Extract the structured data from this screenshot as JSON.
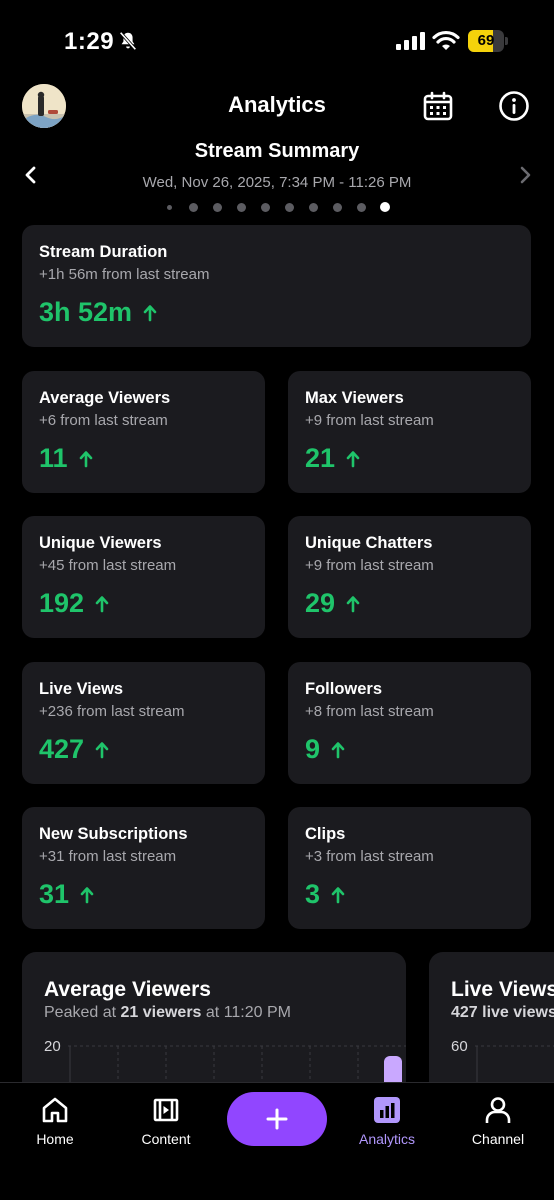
{
  "status_bar": {
    "time": "1:29",
    "battery": "69",
    "battery_level": 0.69
  },
  "header": {
    "title": "Analytics"
  },
  "summary": {
    "title": "Stream Summary",
    "date_range": "Wed, Nov 26, 2025, 7:34 PM - 11:26 PM",
    "page_count": 10,
    "active_page": 10
  },
  "stats": {
    "duration": {
      "title": "Stream Duration",
      "sub": "+1h 56m from last stream",
      "value": "3h 52m"
    },
    "avg_viewers": {
      "title": "Average Viewers",
      "sub": "+6 from last stream",
      "value": "11"
    },
    "max_viewers": {
      "title": "Max Viewers",
      "sub": "+9 from last stream",
      "value": "21"
    },
    "unique_viewers": {
      "title": "Unique Viewers",
      "sub": "+45 from last stream",
      "value": "192"
    },
    "unique_chatters": {
      "title": "Unique Chatters",
      "sub": "+9 from last stream",
      "value": "29"
    },
    "live_views": {
      "title": "Live Views",
      "sub": "+236 from last stream",
      "value": "427"
    },
    "followers": {
      "title": "Followers",
      "sub": "+8 from last stream",
      "value": "9"
    },
    "new_subs": {
      "title": "New Subscriptions",
      "sub": "+31 from last stream",
      "value": "31"
    },
    "clips": {
      "title": "Clips",
      "sub": "+3 from last stream",
      "value": "3"
    }
  },
  "charts": {
    "avg_viewers": {
      "title": "Average Viewers",
      "sub_prefix": "Peaked at ",
      "sub_bold": "21 viewers",
      "sub_suffix": " at 11:20 PM",
      "axis_top": "20"
    },
    "live_views": {
      "title": "Live Views",
      "sub_bold": "427 live views",
      "axis_top": "60"
    }
  },
  "colors": {
    "accent": "#9146ff",
    "positive": "#1fc46a",
    "active_tab": "#b197fc",
    "card": "#1b1b1f"
  },
  "bottom_nav": {
    "home": "Home",
    "content": "Content",
    "add_icon": "plus-icon",
    "analytics": "Analytics",
    "channel": "Channel"
  }
}
